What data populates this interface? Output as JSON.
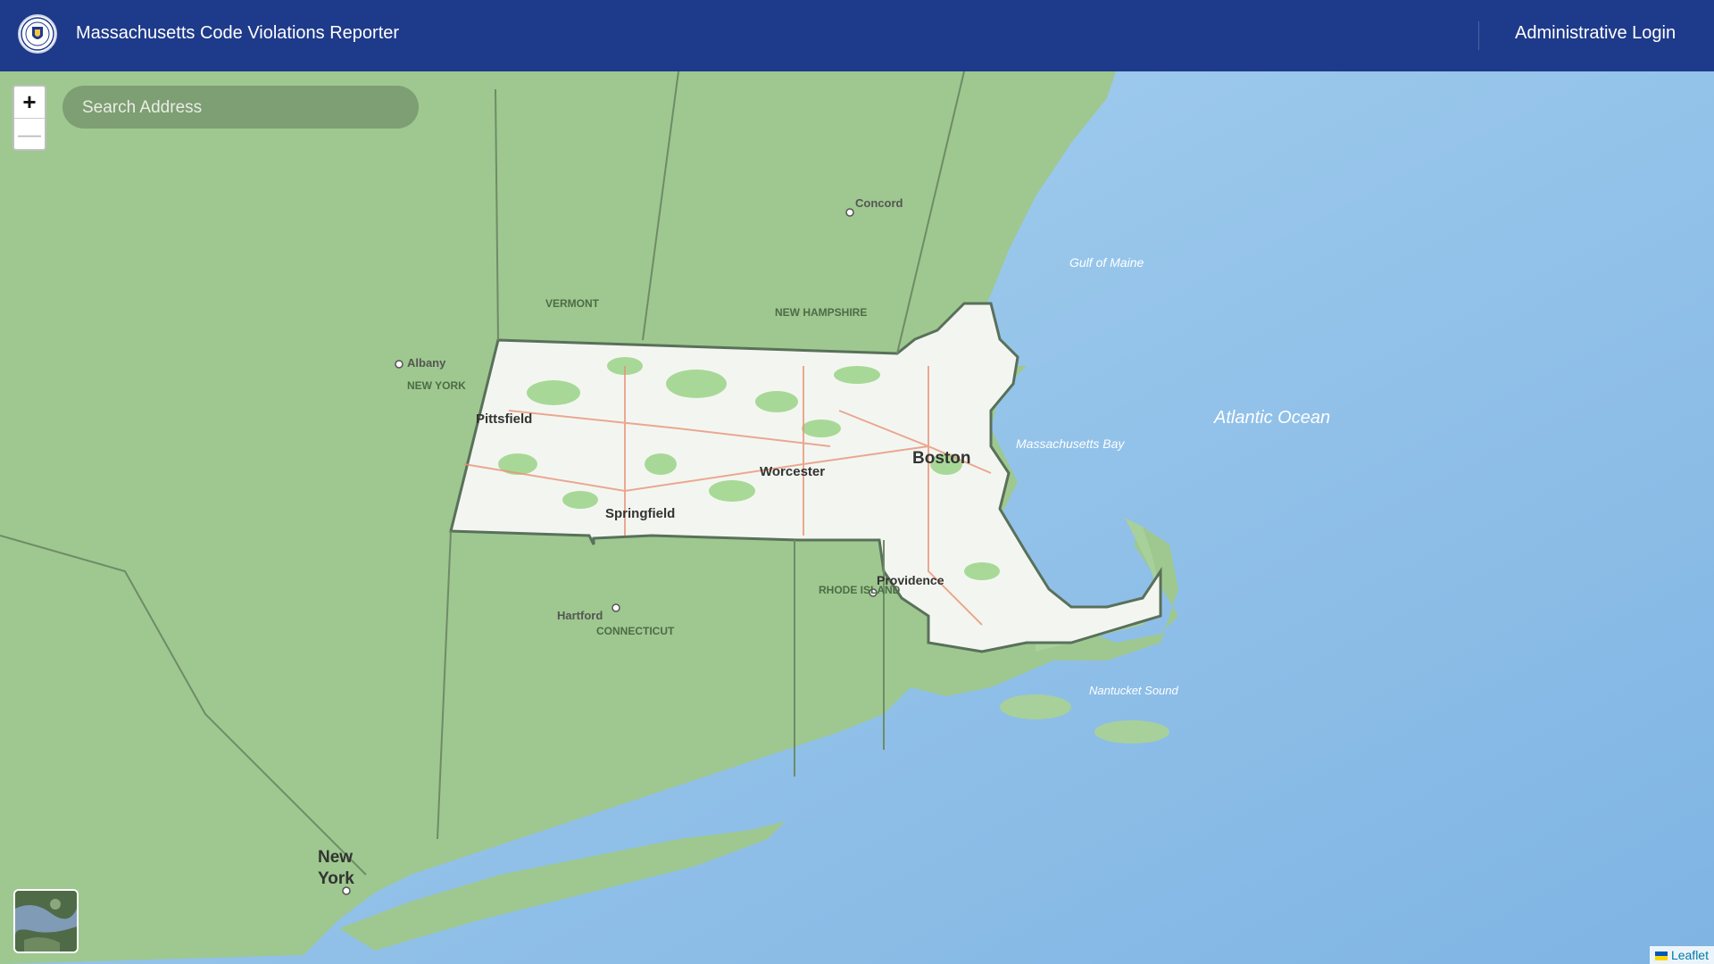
{
  "header": {
    "app_title": "Massachusetts Code Violations Reporter",
    "admin_login_label": "Administrative Login",
    "seal_icon": "massachusetts-seal-icon"
  },
  "map_controls": {
    "zoom_in_label": "+",
    "zoom_out_label": "—",
    "search_placeholder": "Search Address",
    "layer_switcher_icon": "satellite-thumbnail-icon"
  },
  "attribution": {
    "label": "Leaflet"
  },
  "map_labels": {
    "cities": [
      "Pittsfield",
      "Springfield",
      "Worcester",
      "Boston",
      "Providence",
      "Hartford",
      "Concord",
      "Albany",
      "New York"
    ],
    "states": [
      "VERMONT",
      "NEW HAMPSHIRE",
      "NEW YORK",
      "CONNECTICUT",
      "RHODE ISLAND"
    ],
    "water": [
      "Gulf of Maine",
      "Massachusetts Bay",
      "Atlantic Ocean",
      "Nantucket Sound"
    ]
  },
  "colors": {
    "header_bg": "#1e3a8a",
    "land": "#9ec88f",
    "water": "#9ec9ec",
    "highlight_state": "#f3f6f0"
  }
}
